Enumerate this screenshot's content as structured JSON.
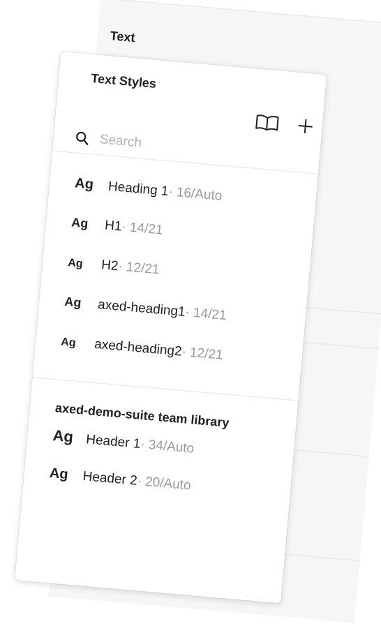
{
  "panel": {
    "section_title": "Text"
  },
  "popover": {
    "title": "Text Styles",
    "search": {
      "placeholder": "Search",
      "value": ""
    },
    "local_styles": [
      {
        "preview": "Ag",
        "name": "Heading 1",
        "meta": " · 16/Auto"
      },
      {
        "preview": "Ag",
        "name": "H1",
        "meta": " · 14/21"
      },
      {
        "preview": "Ag",
        "name": "H2",
        "meta": " · 12/21"
      },
      {
        "preview": "Ag",
        "name": "axed-heading1",
        "meta": " · 14/21"
      },
      {
        "preview": "Ag",
        "name": "axed-heading2",
        "meta": " · 12/21"
      }
    ],
    "team_library": {
      "title": "axed-demo-suite team library",
      "styles": [
        {
          "preview": "Ag",
          "name": "Header 1",
          "meta": " · 34/Auto"
        },
        {
          "preview": "Ag",
          "name": "Header 2",
          "meta": " · 20/Auto"
        }
      ]
    }
  },
  "icons": {
    "style_panel_button": "dots-grid-icon",
    "library": "book-icon",
    "add": "plus-icon",
    "search": "search-icon"
  },
  "colors": {
    "accent": "#1e96ee",
    "muted_text": "#9a9a9a",
    "text": "#222222"
  }
}
